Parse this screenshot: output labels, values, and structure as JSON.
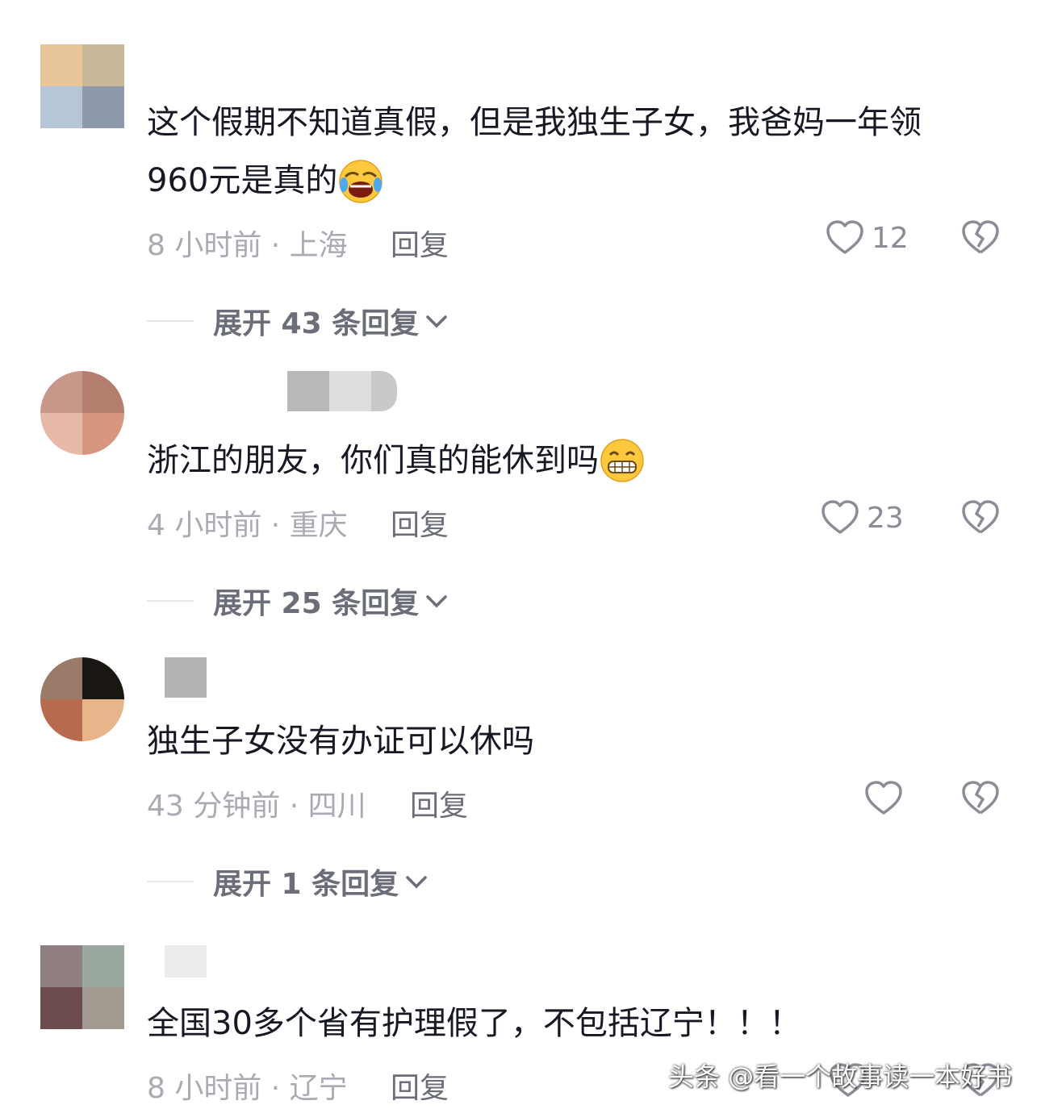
{
  "comments": [
    {
      "text": "这个假期不知道真假，但是我独生子女，我爸妈一年领",
      "text2": "960元是真的",
      "emoji": "rofl-emoji",
      "time_location": "8 小时前 · 上海",
      "reply_label": "回复",
      "likes": "12",
      "expand_label": "展开 43 条回复"
    },
    {
      "text": "浙江的朋友，你们真的能休到吗",
      "emoji": "grin-emoji",
      "time_location": "4 小时前 · 重庆",
      "reply_label": "回复",
      "likes": "23",
      "expand_label": "展开 25 条回复"
    },
    {
      "text": "独生子女没有办证可以休吗",
      "time_location": "43 分钟前 · 四川",
      "reply_label": "回复",
      "likes": "",
      "expand_label": "展开 1 条回复"
    },
    {
      "text": "全国30多个省有护理假了，不包括辽宁！！！",
      "time_location": "8 小时前 · 辽宁",
      "reply_label": "回复"
    }
  ],
  "watermark": "头条 @看一个故事读一本好书",
  "colors": {
    "text": "#161823",
    "meta": "#a9abb3",
    "reply": "#6b6e78"
  },
  "icons": [
    "heart-icon",
    "broken-heart-icon",
    "chevron-down-icon"
  ]
}
